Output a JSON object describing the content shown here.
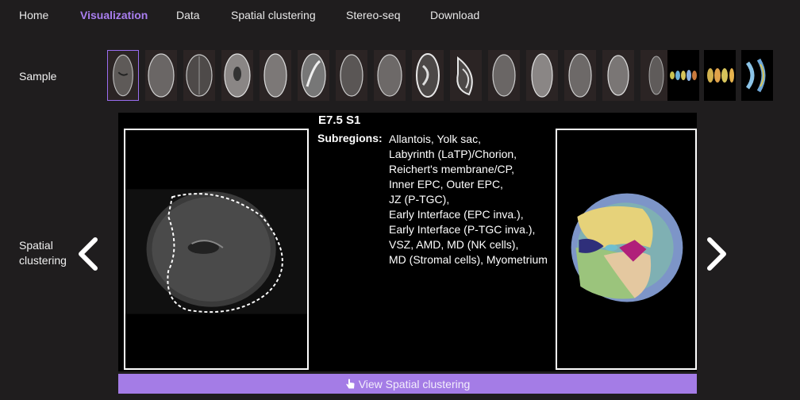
{
  "nav": {
    "items": [
      {
        "label": "Home",
        "active": false
      },
      {
        "label": "Visualization",
        "active": true
      },
      {
        "label": "Data",
        "active": false
      },
      {
        "label": "Spatial clustering",
        "active": false
      },
      {
        "label": "Stereo-seq",
        "active": false
      },
      {
        "label": "Download",
        "active": false
      }
    ]
  },
  "sample": {
    "label": "Sample",
    "thumbnail_count": 18,
    "selected_index": 0
  },
  "spatial": {
    "label_line1": "Spatial",
    "label_line2": "clustering",
    "prev_icon": "chevron-left-icon",
    "next_icon": "chevron-right-icon"
  },
  "panel": {
    "title": "E7.5 S1",
    "subregions_label": "Subregions:",
    "subregions": [
      "Allantois, Yolk sac,",
      "Labyrinth (LaTP)/Chorion,",
      "Reichert's membrane/CP,",
      "Inner EPC, Outer EPC,",
      "JZ (P-TGC),",
      "Early Interface (EPC inva.),",
      "Early Interface (P-TGC inva.),",
      "VSZ, AMD, MD (NK cells),",
      "MD (Stromal cells), Myometrium"
    ]
  },
  "button": {
    "label": "View Spatial clustering",
    "icon": "hand-pointer-icon",
    "color": "#a47ce6"
  },
  "colors": {
    "accent": "#a97ef0",
    "background": "#1f1d1e"
  }
}
